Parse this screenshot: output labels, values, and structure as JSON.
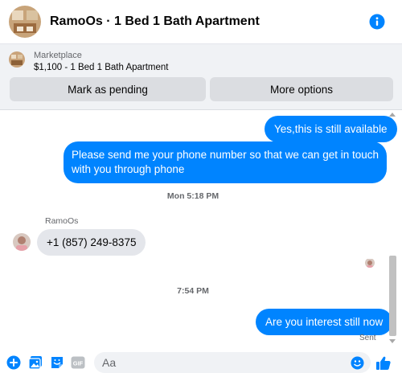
{
  "header": {
    "title": "RamoOs · 1 Bed 1 Bath Apartment"
  },
  "marketplace": {
    "label": "Marketplace",
    "listing": "$1,100 - 1 Bed 1 Bath Apartment",
    "buttons": {
      "pending": "Mark as pending",
      "more": "More options"
    }
  },
  "conversation": {
    "messages_1": {
      "out_1": "Yes,this is still available",
      "out_2_line1": "Please send me your phone  number so that we can get in touch",
      "out_2_line2": "with you through phone"
    },
    "timestamp_1": "Mon 5:18 PM",
    "sender_name": "RamoOs",
    "in_1": "+1 (857) 249-8375",
    "timestamp_2": "7:54 PM",
    "out_3": "Are you interest still now",
    "status": "Sent"
  },
  "composer": {
    "placeholder": "Aa"
  },
  "colors": {
    "accent": "#0084ff",
    "incoming_bubble": "#e4e6eb",
    "bar_bg": "#f0f2f5"
  }
}
